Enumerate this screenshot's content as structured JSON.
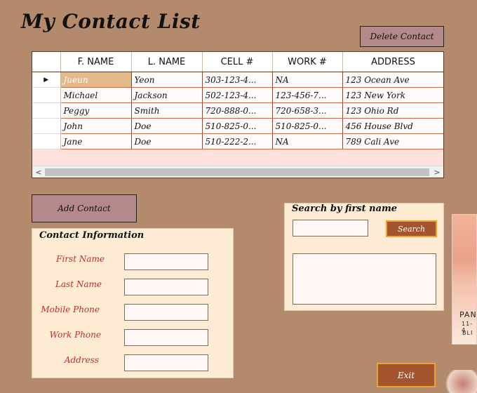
{
  "window": {
    "title": "My Contact List"
  },
  "toolbar": {
    "delete_label": "Delete Contact",
    "add_label": "Add Contact"
  },
  "grid": {
    "columns": [
      "F. NAME",
      "L. NAME",
      "CELL #",
      "WORK #",
      "ADDRESS"
    ],
    "rows": [
      [
        "Jueun",
        "Yeon",
        "303-123-4...",
        "NA",
        "123 Ocean Ave"
      ],
      [
        "Michael",
        "Jackson",
        "502-123-4...",
        "123-456-7...",
        "123 New York"
      ],
      [
        "Peggy",
        "Smith",
        "720-888-0...",
        "720-658-3...",
        "123 Ohio Rd"
      ],
      [
        "John",
        "Doe",
        "510-825-0...",
        "510-825-0...",
        "456 House Blvd"
      ],
      [
        "Jane",
        "Doe",
        "510-222-2...",
        "NA",
        "789 Cali Ave"
      ]
    ],
    "selected_row": 0,
    "scroll_left_arrow": "<",
    "scroll_right_arrow": ">"
  },
  "contact_info": {
    "title": "Contact Information",
    "fields": [
      {
        "label": "First Name",
        "value": ""
      },
      {
        "label": "Last Name",
        "value": ""
      },
      {
        "label": "Mobile Phone",
        "value": ""
      },
      {
        "label": "Work Phone",
        "value": ""
      },
      {
        "label": "Address",
        "value": ""
      }
    ]
  },
  "search": {
    "title": "Search by first name",
    "button_label": "Search",
    "query": "",
    "results": ""
  },
  "exit": {
    "label": "Exit"
  },
  "side_image": {
    "text1": "PAN",
    "text2": "11-4",
    "text3": "BLI"
  },
  "colors": {
    "background": "#b38a6c",
    "button_brown": "#a3552e",
    "button_pink": "#b5888a",
    "accent_orange": "#f0a030"
  }
}
